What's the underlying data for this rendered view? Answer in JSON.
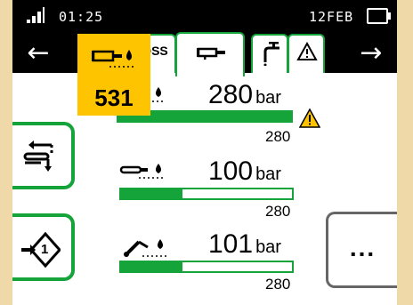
{
  "status_bar": {
    "time": "01:25",
    "date": "12FEB"
  },
  "nav": {
    "back_icon": "arrow-left-icon",
    "forward_icon": "arrow-right-icon",
    "back_glyph": "←",
    "forward_glyph": "→"
  },
  "tabs": [
    {
      "label": "OSS",
      "icon": "truncated-tab"
    },
    {
      "label": "",
      "icon": "cylinder-icon",
      "active": true
    },
    {
      "label": "",
      "icon": "faucet-icon"
    },
    {
      "label": "",
      "icon": "warning-icon"
    }
  ],
  "highlight": {
    "icon": "cylinder-drop-icon",
    "value": "531"
  },
  "rows": [
    {
      "icon": "cylinder-drop-icon",
      "value": "280",
      "unit": "bar",
      "limit": "280",
      "fill_percent": 100,
      "warning": true
    },
    {
      "icon": "conveyor-drop-icon",
      "value": "100",
      "unit": "bar",
      "limit": "280",
      "fill_percent": 36,
      "warning": false
    },
    {
      "icon": "arm-drop-icon",
      "value": "101",
      "unit": "bar",
      "limit": "280",
      "fill_percent": 36,
      "warning": false
    }
  ],
  "side_buttons": [
    {
      "icon": "transfer-arrows-icon"
    },
    {
      "icon": "step-1-diamond-icon",
      "label": "1"
    }
  ],
  "more_button": {
    "label": "..."
  },
  "colors": {
    "accent": "#15a43a",
    "highlight": "#ffc400",
    "background": "#000000",
    "warning": "#ffc400"
  }
}
